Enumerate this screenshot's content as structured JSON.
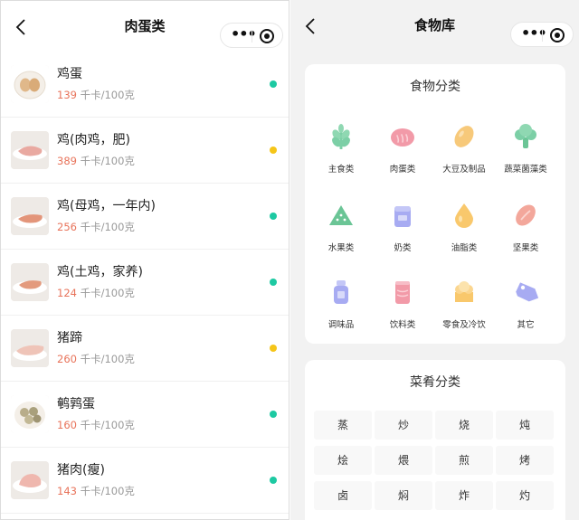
{
  "left_screen": {
    "title": "肉蛋类",
    "unit": "千卡/100克",
    "items": [
      {
        "name": "鸡蛋",
        "kcal": "139",
        "dot": "#1dc9a2"
      },
      {
        "name": "鸡(肉鸡，肥)",
        "kcal": "389",
        "dot": "#f5c518"
      },
      {
        "name": "鸡(母鸡，一年内)",
        "kcal": "256",
        "dot": "#1dc9a2"
      },
      {
        "name": "鸡(土鸡，家养)",
        "kcal": "124",
        "dot": "#1dc9a2"
      },
      {
        "name": "猪蹄",
        "kcal": "260",
        "dot": "#f5c518"
      },
      {
        "name": "鹌鹑蛋",
        "kcal": "160",
        "dot": "#1dc9a2"
      },
      {
        "name": "猪肉(瘦)",
        "kcal": "143",
        "dot": "#1dc9a2"
      }
    ]
  },
  "right_screen": {
    "title": "食物库",
    "food_category": {
      "title": "食物分类",
      "items": [
        {
          "label": "主食类",
          "icon": "wheat-icon"
        },
        {
          "label": "肉蛋类",
          "icon": "meat-icon"
        },
        {
          "label": "大豆及制品",
          "icon": "soybean-icon"
        },
        {
          "label": "蔬菜菌藻类",
          "icon": "broccoli-icon"
        },
        {
          "label": "水果类",
          "icon": "watermelon-icon"
        },
        {
          "label": "奶类",
          "icon": "milk-icon"
        },
        {
          "label": "油脂类",
          "icon": "oil-drop-icon"
        },
        {
          "label": "坚果类",
          "icon": "nut-icon"
        },
        {
          "label": "调味品",
          "icon": "seasoning-bottle-icon"
        },
        {
          "label": "饮料类",
          "icon": "drink-can-icon"
        },
        {
          "label": "零食及冷饮",
          "icon": "snack-icon"
        },
        {
          "label": "其它",
          "icon": "tag-icon"
        }
      ]
    },
    "dish_category": {
      "title": "菜肴分类",
      "items": [
        "蒸",
        "炒",
        "烧",
        "炖",
        "烩",
        "煨",
        "煎",
        "烤",
        "卤",
        "焖",
        "炸",
        "灼"
      ]
    }
  }
}
